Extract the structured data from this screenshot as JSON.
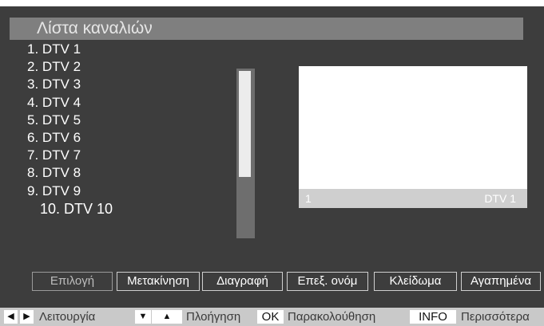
{
  "title": "Λίστα καναλιών",
  "channels": [
    "1. DTV 1",
    "2. DTV 2",
    "3. DTV 3",
    "4. DTV 4",
    "5. DTV 5",
    "6. DTV 6",
    "7. DTV 7",
    "8. DTV 8",
    "9. DTV 9",
    "10. DTV 10"
  ],
  "selected_channel_index": 10,
  "preview": {
    "number": "1",
    "name": "DTV 1"
  },
  "actions": [
    "Επιλογή",
    "Μετακίνηση",
    "Διαγραφή",
    "Επεξ. ονόμ",
    "Κλείδωμα",
    "Αγαπημένα"
  ],
  "help": {
    "left_key": "◀",
    "right_key": "▶",
    "function_label": "Λειτουργία",
    "down_key": "▼",
    "up_key": "▲",
    "navigation_label": "Πλοήγηση",
    "ok_key": "OK",
    "watch_label": "Παρακολούθηση",
    "info_key": "INFO",
    "more_label": "Περισσότερα"
  },
  "colors": {
    "background": "#3d3d3d",
    "title_bar": "#7f7f7f",
    "help_bar": "#c9c9c9",
    "preview_info": "#cfcfcf"
  }
}
